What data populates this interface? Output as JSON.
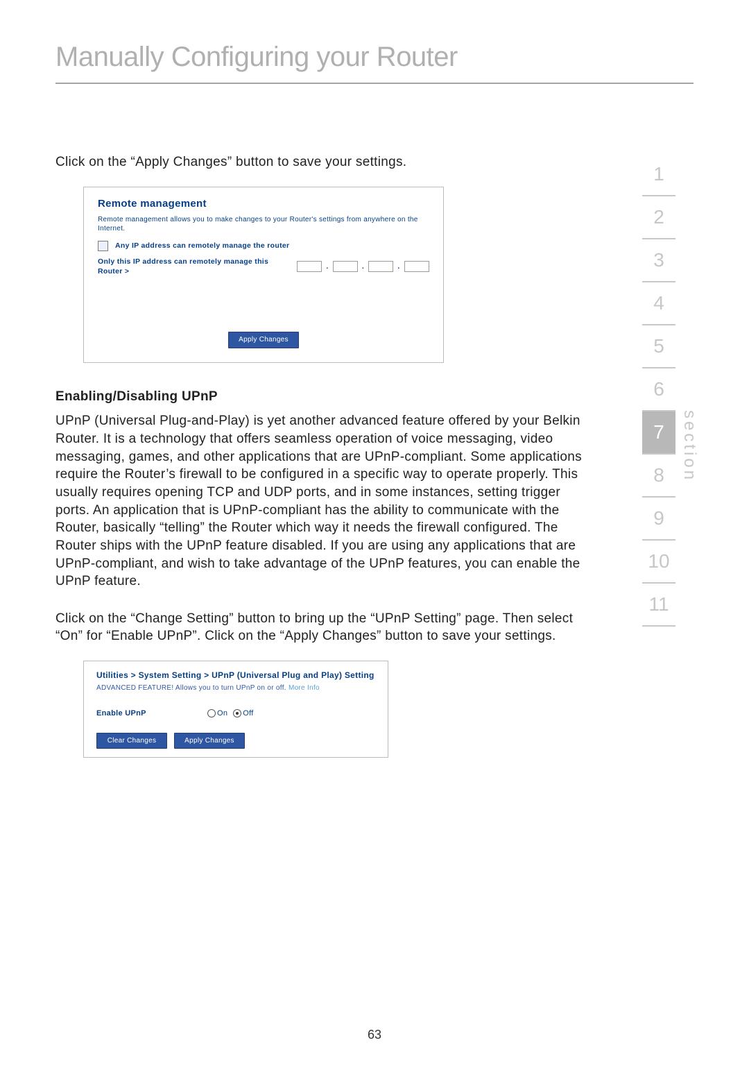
{
  "title": "Manually Configuring your Router",
  "intro": "Click on the “Apply Changes” button to save your settings.",
  "remote": {
    "heading": "Remote management",
    "desc": "Remote management allows you to make changes to your Router's settings from anywhere on the Internet.",
    "opt_any": "Any IP address can remotely manage the router",
    "opt_only": "Only this IP address can remotely manage this Router >",
    "apply": "Apply Changes"
  },
  "upnp": {
    "subheading": "Enabling/Disabling UPnP",
    "body": "UPnP (Universal Plug-and-Play) is yet another advanced feature offered by your Belkin Router. It is a technology that offers seamless operation of voice messaging, video messaging, games, and other applications that are UPnP-compliant. Some applications require the Router’s firewall to be configured in a specific way to operate properly. This usually requires opening TCP and UDP ports, and in some instances, setting trigger ports. An application that is UPnP-compliant has the ability to communicate with the Router, basically “telling” the Router which way it needs the firewall configured. The Router ships with the UPnP feature disabled. If you are using any applications that are UPnP-compliant, and wish to take advantage of the UPnP features, you can enable the UPnP feature.",
    "body2": "Click on the “Change Setting” button to bring up the “UPnP Setting” page. Then select “On” for “Enable UPnP”. Click on the “Apply Changes” button to save your settings."
  },
  "upnp_panel": {
    "crumb": "Utilities > System Setting > UPnP (Universal Plug and Play) Setting",
    "desc_prefix": "ADVANCED FEATURE! Allows you to turn UPnP on or off. ",
    "desc_link": "More Info",
    "label": "Enable UPnP",
    "on": "On",
    "off": "Off",
    "selected": "off",
    "clear": "Clear Changes",
    "apply": "Apply Changes"
  },
  "sidebar": {
    "label": "section",
    "items": [
      "1",
      "2",
      "3",
      "4",
      "5",
      "6",
      "7",
      "8",
      "9",
      "10",
      "11"
    ],
    "active_index": 6
  },
  "page_number": "63"
}
